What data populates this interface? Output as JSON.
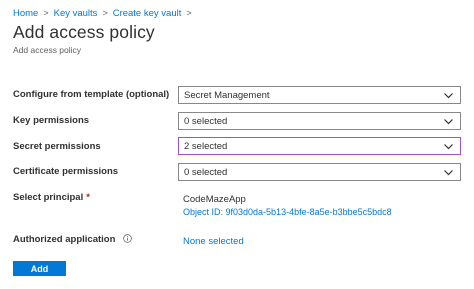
{
  "breadcrumb": {
    "items": [
      "Home",
      "Key vaults",
      "Create key vault"
    ],
    "separator": ">"
  },
  "page": {
    "title": "Add access policy",
    "subtitle": "Add access policy"
  },
  "form": {
    "template": {
      "label": "Configure from template (optional)",
      "value": "Secret Management"
    },
    "key_permissions": {
      "label": "Key permissions",
      "value": "0 selected"
    },
    "secret_permissions": {
      "label": "Secret permissions",
      "value": "2 selected"
    },
    "certificate_permissions": {
      "label": "Certificate permissions",
      "value": "0 selected"
    },
    "principal": {
      "label": "Select principal",
      "required_marker": "*",
      "name": "CodeMazeApp",
      "object_id": "Object ID: 9f03d0da-5b13-4bfe-8a5e-b3bbe5c5bdc8"
    },
    "authorized_application": {
      "label": "Authorized application",
      "value": "None selected"
    }
  },
  "actions": {
    "add_label": "Add"
  },
  "colors": {
    "link": "#0078d4",
    "primary_button": "#0078d4",
    "focused_border": "#a64fc2",
    "required": "#a4262c",
    "text": "#323130"
  },
  "icons": {
    "dropdown": "chevron-down-icon",
    "info": "info-icon",
    "breadcrumb_separator": "chevron-right-icon"
  }
}
